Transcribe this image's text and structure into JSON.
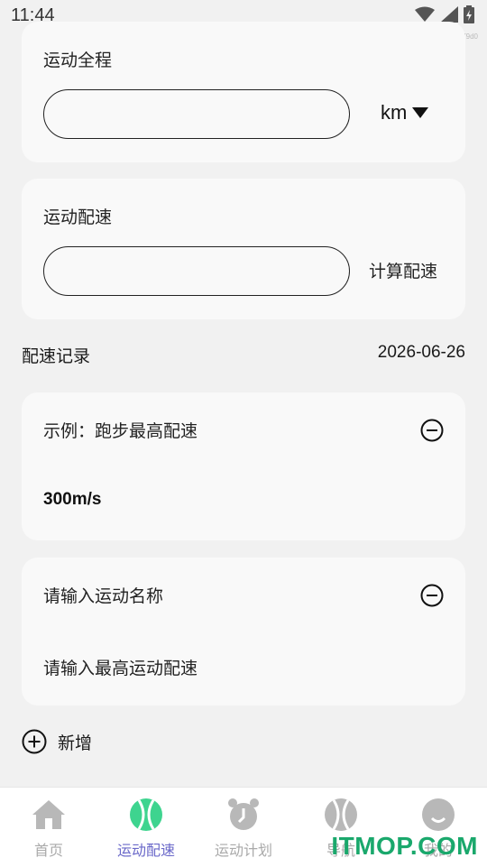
{
  "status": {
    "time": "11:44",
    "corner_text": "7c8479d0"
  },
  "distance_card": {
    "title": "运动全程",
    "input_value": "",
    "unit": "km"
  },
  "pace_card": {
    "title": "运动配速",
    "input_value": "",
    "calc_button": "计算配速"
  },
  "records": {
    "heading": "配速记录",
    "date": "2026-06-26",
    "items": [
      {
        "name": "示例：跑步最高配速",
        "value": "300m/s"
      },
      {
        "name": "请输入运动名称",
        "value": "请输入最高运动配速"
      }
    ],
    "add_label": "新增"
  },
  "tabs": [
    {
      "label": "首页",
      "icon": "home-icon",
      "active": false
    },
    {
      "label": "运动配速",
      "icon": "tennis-ball-icon",
      "active": true
    },
    {
      "label": "运动计划",
      "icon": "alarm-clock-icon",
      "active": false
    },
    {
      "label": "导航",
      "icon": "ball-icon",
      "active": false
    },
    {
      "label": "我的",
      "icon": "smile-icon",
      "active": false
    }
  ],
  "watermark": "ITMOP.COM",
  "colors": {
    "accent": "#6a68c9",
    "active_icon": "#3ed48f",
    "inactive_icon": "#b8b8b8",
    "brand": "#1aa86c"
  }
}
